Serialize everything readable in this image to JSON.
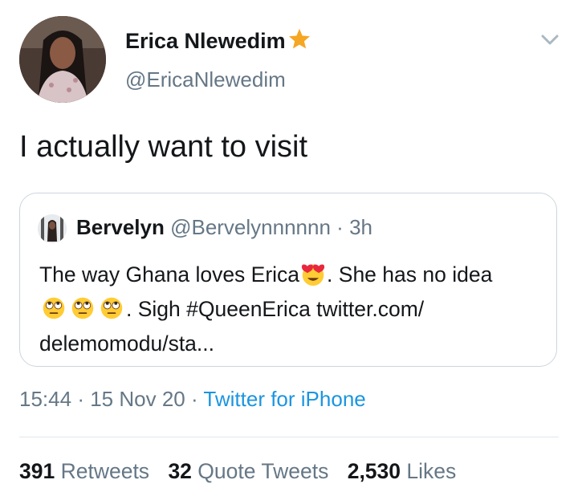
{
  "tweet": {
    "author_name": "Erica Nlewedim",
    "author_handle": "@EricaNlewedim",
    "text": "I actually want to visit",
    "timestamp_time": "15:44",
    "timestamp_date": "15 Nov 20",
    "source": "Twitter for iPhone",
    "dot": "·"
  },
  "quoted": {
    "author_name": "Bervelyn",
    "author_handle": "@Bervelynnnnnn",
    "age": "3h",
    "text_part1": "The way Ghana loves Erica",
    "text_part2": ". She has no idea",
    "text_part3": ". Sigh #QueenErica twitter.com/",
    "text_part4": "delemomodu/sta..."
  },
  "stats": {
    "retweets_count": "391",
    "retweets_label": "Retweets",
    "quote_count": "32",
    "quote_label": "Quote Tweets",
    "likes_count": "2,530",
    "likes_label": "Likes"
  },
  "colors": {
    "link": "#1b95e0",
    "secondary_text": "#657786",
    "star": "#f5a623"
  },
  "icons": [
    "verified-star-icon",
    "chevron-down-icon",
    "heart-eyes-emoji-icon",
    "rolling-eyes-emoji-icon"
  ]
}
